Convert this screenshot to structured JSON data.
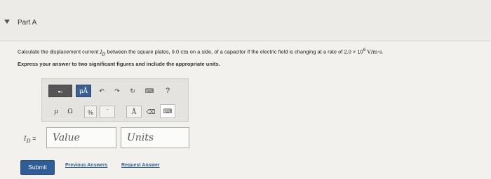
{
  "part": {
    "title": "Part A"
  },
  "question": {
    "intro": "Calculate the displacement current",
    "symbol": "I",
    "symbol_sub": "D",
    "mid": " between the square plates, 9.0",
    "side_unit": "cm",
    "rest": " on a side, of a capacitor if the electric field is changing at a rate of 2.0 × 10",
    "exponent": "6",
    "rate_unit": "V/m·s",
    "end": "."
  },
  "instruction": "Express your answer to two significant figures and include the appropriate units.",
  "toolbar": {
    "template_label": "▪▫",
    "mu_a_label": "μÅ",
    "undo_label": "↶",
    "redo_label": "↷",
    "reset_label": "↻",
    "keyboard_label": "⌨",
    "help_label": "?",
    "mu_label": "μ",
    "ohm_label": "Ω",
    "percent_label": "%",
    "dot_label": "·",
    "angstrom_label": "Å",
    "delete_label": "⌫",
    "keyboard2_label": "⌨"
  },
  "answer": {
    "label_symbol": "I",
    "label_sub": "D",
    "label_eq": " =",
    "value_placeholder": "Value",
    "units_placeholder": "Units"
  },
  "buttons": {
    "submit_label": "Submit",
    "previous_answers_label": "Previous Answers",
    "request_answer_label": "Request Answer"
  },
  "colors": {
    "accent": "#2f5e96",
    "mu_a_button": "#3b5e8f"
  }
}
